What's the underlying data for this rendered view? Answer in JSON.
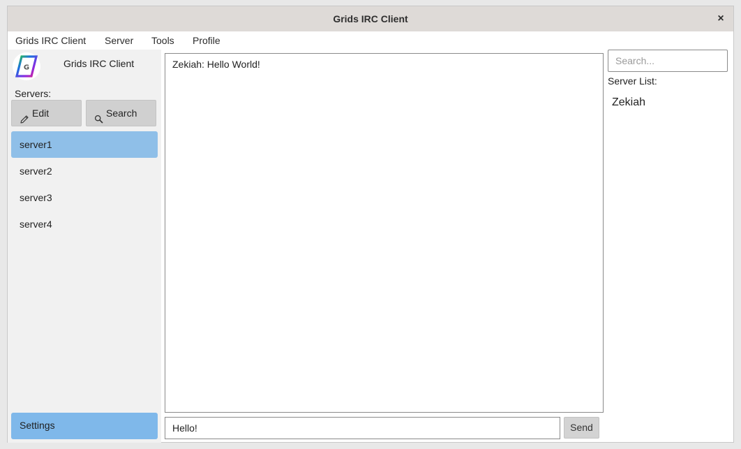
{
  "window": {
    "title": "Grids IRC Client",
    "close_icon": "close-icon",
    "close_glyph": "×"
  },
  "menubar": {
    "items": [
      {
        "label": "Grids IRC Client"
      },
      {
        "label": "Server"
      },
      {
        "label": "Tools"
      },
      {
        "label": "Profile"
      }
    ]
  },
  "sidebar": {
    "logo_icon": "grids-logo-icon",
    "logo_letter": "G",
    "app_name": "Grids IRC Client",
    "servers_label": "Servers:",
    "edit_button": {
      "label": "Edit",
      "icon": "pencil-icon"
    },
    "search_button": {
      "label": "Search",
      "icon": "magnifier-icon"
    },
    "servers": [
      {
        "name": "server1",
        "selected": true
      },
      {
        "name": "server2",
        "selected": false
      },
      {
        "name": "server3",
        "selected": false
      },
      {
        "name": "server4",
        "selected": false
      }
    ],
    "settings_label": "Settings"
  },
  "chat": {
    "messages": [
      {
        "text": "Zekiah: Hello World!"
      }
    ],
    "input_value": "Hello!",
    "send_label": "Send"
  },
  "right_panel": {
    "search_placeholder": "Search...",
    "server_list_label": "Server List:",
    "users": [
      {
        "name": "Zekiah"
      }
    ]
  },
  "colors": {
    "titlebar": "#dedad7",
    "selected_item": "#8fbfe8",
    "settings_button": "#7fb8ea",
    "button_gray": "#d0d0d0"
  }
}
